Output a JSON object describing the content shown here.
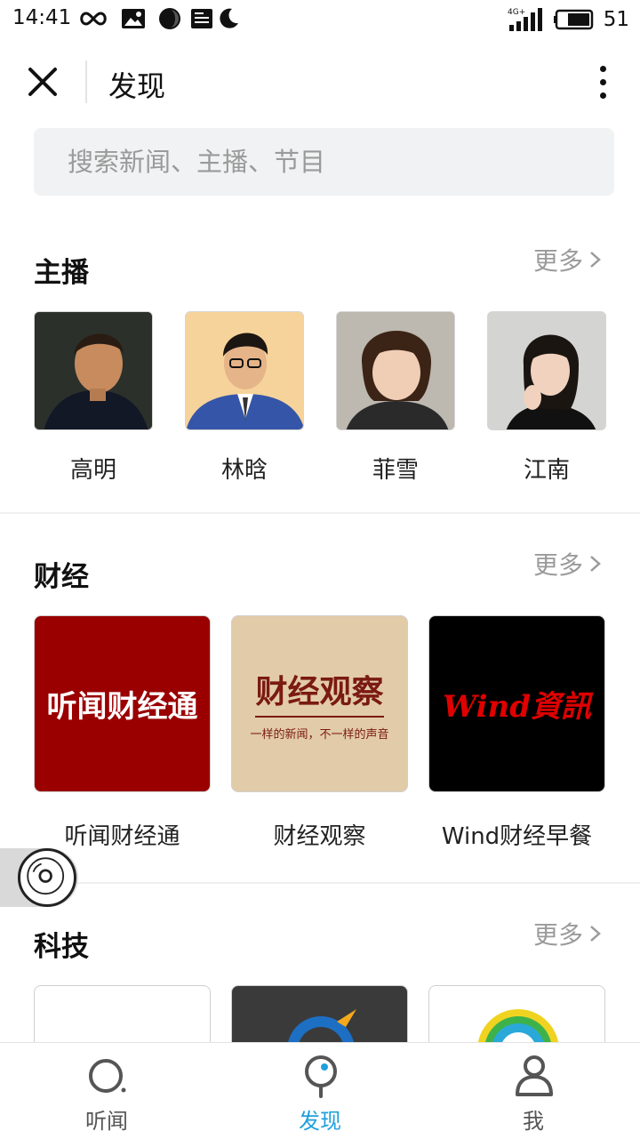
{
  "status_bar": {
    "time": "14:41",
    "network": "4G+",
    "battery": "51"
  },
  "header": {
    "title": "发现"
  },
  "search": {
    "placeholder": "搜索新闻、主播、节目"
  },
  "anchors_section": {
    "title": "主播",
    "more_label": "更多",
    "items": [
      {
        "name": "高明"
      },
      {
        "name": "林晗"
      },
      {
        "name": "菲雪"
      },
      {
        "name": "江南"
      }
    ]
  },
  "finance_section": {
    "title": "财经",
    "more_label": "更多",
    "items": [
      {
        "name": "听闻财经通",
        "logo_text": "听闻财经通",
        "bg": "#990000"
      },
      {
        "name": "财经观察",
        "logo_text": "财经观察",
        "logo_subtext": "一样的新闻，不一样的声音",
        "bg": "#e0c9a6"
      },
      {
        "name": "Wind财经早餐",
        "logo_text": "Wind資訊",
        "bg": "#000000"
      }
    ]
  },
  "tech_section": {
    "title": "科技",
    "more_label": "更多"
  },
  "bottom_nav": {
    "items": [
      {
        "label": "听闻",
        "icon": "listen-icon"
      },
      {
        "label": "发现",
        "icon": "discover-icon",
        "active": true
      },
      {
        "label": "我",
        "icon": "profile-icon"
      }
    ]
  },
  "colors": {
    "accent": "#1fa0dc",
    "text": "#222222",
    "muted": "#9a9a9a"
  }
}
